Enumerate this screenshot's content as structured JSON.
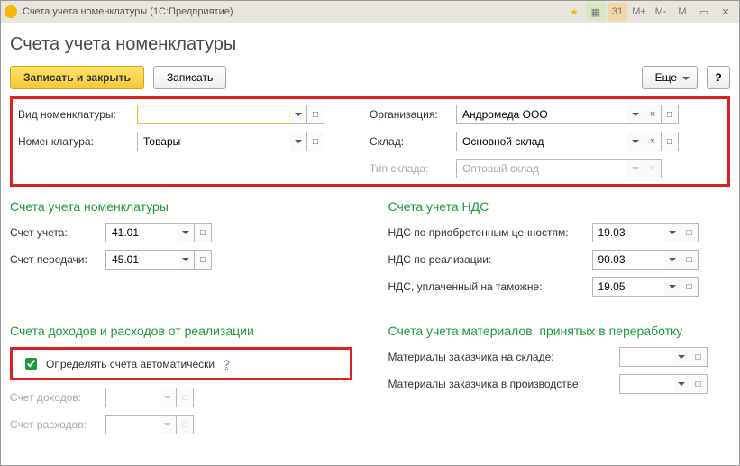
{
  "titlebar": {
    "title": "Счета учета номенклатуры  (1С:Предприятие)"
  },
  "header": {
    "title": "Счета учета номенклатуры"
  },
  "toolbar": {
    "save_close": "Записать и закрыть",
    "save": "Записать",
    "more": "Еще",
    "help": "?"
  },
  "top": {
    "type_label": "Вид номенклатуры:",
    "type_value": "",
    "nomen_label": "Номенклатура:",
    "nomen_value": "Товары",
    "org_label": "Организация:",
    "org_value": "Андромеда ООО",
    "wh_label": "Склад:",
    "wh_value": "Основной склад",
    "wtype_label": "Тип склада:",
    "wtype_value": "Оптовый склад"
  },
  "acct": {
    "title": "Счета учета номенклатуры",
    "acct_label": "Счет учета:",
    "acct_value": "41.01",
    "transfer_label": "Счет передачи:",
    "transfer_value": "45.01"
  },
  "vat": {
    "title": "Счета учета НДС",
    "purch_label": "НДС по приобретенным ценностям:",
    "purch_value": "19.03",
    "sales_label": "НДС по реализации:",
    "sales_value": "90.03",
    "customs_label": "НДС, уплаченный на таможне:",
    "customs_value": "19.05"
  },
  "inc": {
    "title": "Счета доходов и расходов от реализации",
    "auto_label": "Определять счета автоматически",
    "qm": "?",
    "income_label": "Счет доходов:",
    "expense_label": "Счет расходов:"
  },
  "mat": {
    "title": "Счета учета материалов, принятых в переработку",
    "stock_label": "Материалы заказчика на складе:",
    "prod_label": "Материалы заказчика в производстве:"
  }
}
